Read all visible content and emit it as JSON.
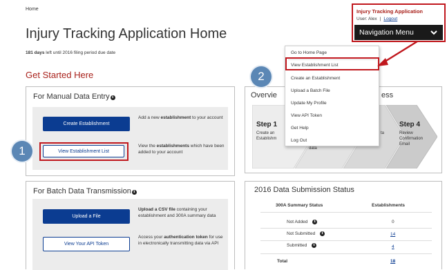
{
  "breadcrumb": "Home",
  "page_title": "Injury Tracking Application Home",
  "days_note": {
    "count": "181 days",
    "text": "left until 2016 filing period due date"
  },
  "section_title": "Get Started Here",
  "manual": {
    "title": "For Manual Data Entry",
    "create_button": "Create Establishment",
    "create_desc_pre": "Add a new ",
    "create_desc_bold": "establishment",
    "create_desc_post": " to your account",
    "view_button": "View Establishment List",
    "view_desc_pre": "View the ",
    "view_desc_bold": "establishments",
    "view_desc_post": " which have been added to your account"
  },
  "batch": {
    "title": "For Batch Data Transmission",
    "upload_button": "Upload a File",
    "upload_desc_bold": "Upload a CSV file",
    "upload_desc_post": " containing your establishment and 300A summary data",
    "api_button": "View Your API Token",
    "api_desc_pre": "Access your ",
    "api_desc_bold": "authentication token",
    "api_desc_post": " for use in electronically transmitting data via API"
  },
  "overview": {
    "title_left": "Overvie",
    "title_right": "ess",
    "step1_title": "Step 1",
    "step1_text": [
      "Create an",
      "Establishm"
    ],
    "step3_text": [
      "ta"
    ],
    "step3b_text": [
      "data"
    ],
    "step4_title": "Step 4",
    "step4_text": [
      "Review",
      "Confirmation",
      "Email"
    ]
  },
  "status": {
    "title": "2016 Data Submission Status",
    "col1": "300A Summary Status",
    "col2": "Establishments",
    "rows": [
      {
        "label": "Not Added",
        "value": "0"
      },
      {
        "label": "Not Submitted",
        "value": "14"
      },
      {
        "label": "Submitted",
        "value": "4"
      }
    ],
    "total_label": "Total",
    "total_value": "18"
  },
  "nav": {
    "app_title": "Injury Tracking Application",
    "user_label": "User: Alex",
    "logout": "Logout",
    "menu_button": "Navigation Menu",
    "menu_items": [
      "Go to Home Page",
      "View Establishment List",
      "Create an Establishment",
      "Upload a Batch File",
      "Update My Profile",
      "View API Token",
      "Get Help",
      "Log Out"
    ]
  },
  "annotations": {
    "badge1": "1",
    "badge2": "2"
  },
  "colors": {
    "brand_blue": "#0b3c91",
    "callout_red": "#c0171d",
    "title_red": "#a8201a",
    "badge_blue": "#5b87b5",
    "nav_dark": "#1a1a1a"
  }
}
